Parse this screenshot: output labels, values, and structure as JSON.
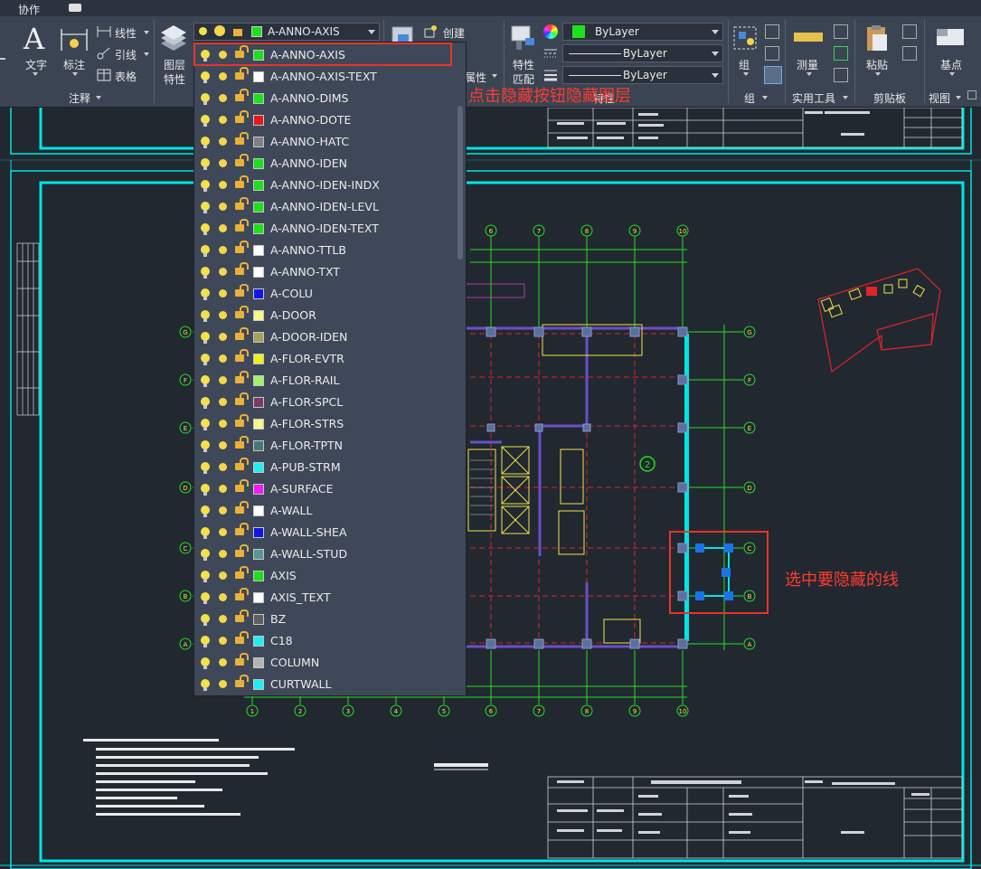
{
  "ribbon": {
    "top_tab": "协作",
    "annotate_panel": {
      "text_label": "文字",
      "dim_label": "标注",
      "linear_label": "线性",
      "leader_label": "引线",
      "table_label": "表格",
      "panel_title": "注释"
    },
    "layers_panel": {
      "props_label_1": "图层",
      "props_label_2": "特性",
      "current_layer": "A-ANNO-AXIS"
    },
    "block_panel": {
      "create_label": "创建"
    },
    "properties_panel": {
      "match_label_1": "特性",
      "match_label_2": "匹配",
      "color_value": "ByLayer",
      "linetype_value": "ByLayer",
      "lineweight_value": "ByLayer",
      "attr_label": "属性",
      "panel_title_partial": "特性"
    },
    "groups_panel": {
      "group_label": "组",
      "panel_title": "组"
    },
    "utilities_panel": {
      "measure_label": "测量",
      "panel_title": "实用工具"
    },
    "clipboard_panel": {
      "paste_label": "粘贴",
      "panel_title": "剪贴板"
    },
    "view_panel": {
      "base_label": "基点",
      "panel_title": "视图"
    }
  },
  "layer_list": {
    "layers": [
      {
        "name": "A-ANNO-AXIS",
        "color": "#1ee01e"
      },
      {
        "name": "A-ANNO-AXIS-TEXT",
        "color": "#ffffff"
      },
      {
        "name": "A-ANNO-DIMS",
        "color": "#1ee01e"
      },
      {
        "name": "A-ANNO-DOTE",
        "color": "#e01b1b"
      },
      {
        "name": "A-ANNO-HATC",
        "color": "#808080"
      },
      {
        "name": "A-ANNO-IDEN",
        "color": "#1ee01e"
      },
      {
        "name": "A-ANNO-IDEN-INDX",
        "color": "#1ee01e"
      },
      {
        "name": "A-ANNO-IDEN-LEVL",
        "color": "#1ee01e"
      },
      {
        "name": "A-ANNO-IDEN-TEXT",
        "color": "#1ee01e"
      },
      {
        "name": "A-ANNO-TTLB",
        "color": "#ffffff"
      },
      {
        "name": "A-ANNO-TXT",
        "color": "#ffffff"
      },
      {
        "name": "A-COLU",
        "color": "#1414e6"
      },
      {
        "name": "A-DOOR",
        "color": "#f6f68a"
      },
      {
        "name": "A-DOOR-IDEN",
        "color": "#a3a35a"
      },
      {
        "name": "A-FLOR-EVTR",
        "color": "#f0f01e"
      },
      {
        "name": "A-FLOR-RAIL",
        "color": "#a6f06e"
      },
      {
        "name": "A-FLOR-SPCL",
        "color": "#7a3a66"
      },
      {
        "name": "A-FLOR-STRS",
        "color": "#f6f68a"
      },
      {
        "name": "A-FLOR-TPTN",
        "color": "#4a7676"
      },
      {
        "name": "A-PUB-STRM",
        "color": "#1ef0f0"
      },
      {
        "name": "A-SURFACE",
        "color": "#f01ef0"
      },
      {
        "name": "A-WALL",
        "color": "#ffffff"
      },
      {
        "name": "A-WALL-SHEA",
        "color": "#1414e6"
      },
      {
        "name": "A-WALL-STUD",
        "color": "#5a9696"
      },
      {
        "name": "AXIS",
        "color": "#1ee01e"
      },
      {
        "name": "AXIS_TEXT",
        "color": "#ffffff"
      },
      {
        "name": "BZ",
        "color": "#606060"
      },
      {
        "name": "C18",
        "color": "#1ef0f0"
      },
      {
        "name": "COLUMN",
        "color": "#b4b4b4"
      },
      {
        "name": "CURTWALL",
        "color": "#1ef0f0"
      }
    ]
  },
  "annotations": {
    "select_layer_hint": "选择图层，点击隐藏按钮隐藏图层",
    "select_line_hint": "选中要隐藏的线"
  },
  "drawing": {
    "axis_row_labels": [
      "G",
      "F",
      "E",
      "D",
      "C",
      "B",
      "A"
    ],
    "axis_col_top": [
      "6",
      "7",
      "8",
      "9",
      "10"
    ],
    "axis_col_bottom": [
      "1",
      "2",
      "3",
      "4",
      "5",
      "6",
      "7",
      "8",
      "9",
      "10"
    ],
    "circle_2": "2"
  },
  "colors": {
    "frame_cyan": "#00e5e5",
    "axis_green": "#22e022",
    "grid_red": "#e0242a",
    "wall_purple": "#6a4fc9",
    "column_fill": "#5a6fa0",
    "annotation_red": "#ff3b2f",
    "canvas_bg": "#212830"
  }
}
